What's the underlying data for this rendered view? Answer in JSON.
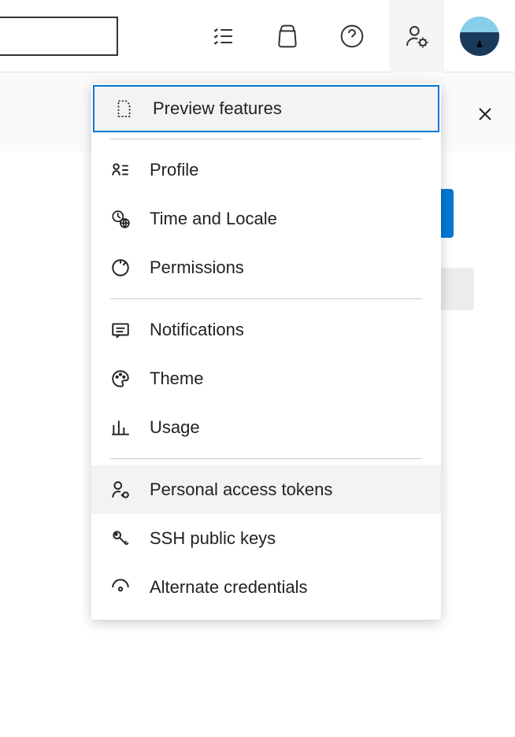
{
  "menu": {
    "items": [
      {
        "label": "Preview features",
        "highlighted": true
      },
      {
        "label": "Profile"
      },
      {
        "label": "Time and Locale"
      },
      {
        "label": "Permissions"
      },
      {
        "label": "Notifications"
      },
      {
        "label": "Theme"
      },
      {
        "label": "Usage"
      },
      {
        "label": "Personal access tokens",
        "hover": true
      },
      {
        "label": "SSH public keys"
      },
      {
        "label": "Alternate credentials"
      }
    ]
  }
}
